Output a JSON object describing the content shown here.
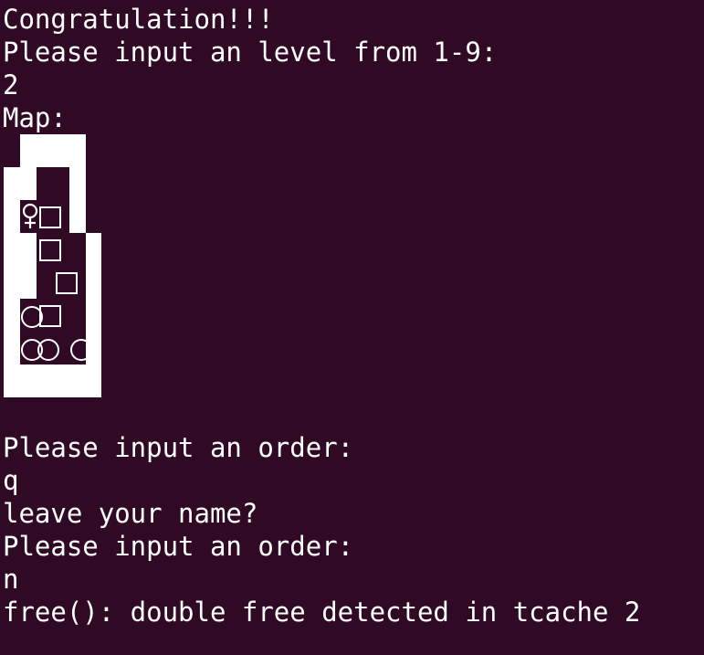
{
  "terminal": {
    "lines_before_map": [
      "Congratulation!!!",
      "Please input an level from 1-9:",
      "2",
      "Map:"
    ],
    "lines_after_map": [
      "Please input an order:",
      "q",
      "leave your name?",
      "Please input an order:",
      "n",
      "free(): double free detected in tcache 2"
    ]
  },
  "map": {
    "glyph_types": {
      "player": "female-sign-icon",
      "box": "square-icon",
      "goal": "circle-icon"
    }
  },
  "colors": {
    "background": "#300a24",
    "foreground": "#ffffff"
  }
}
